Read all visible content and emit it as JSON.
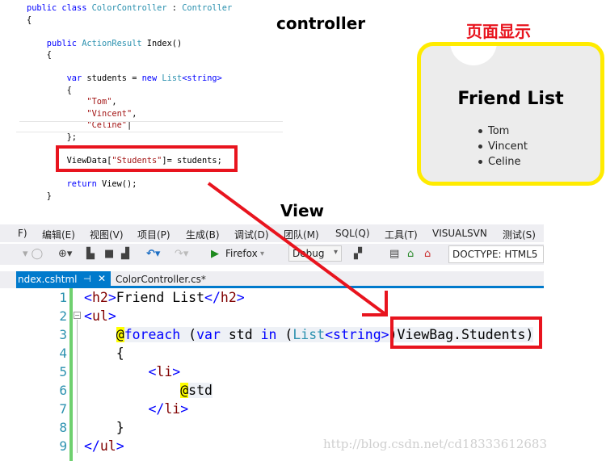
{
  "colors": {
    "keyword": "#0000ff",
    "type": "#2b91af",
    "string": "#a31515",
    "tag": "#800000",
    "plain": "#000000",
    "accent": "#007acc",
    "highlight_box": "#e8141e",
    "panel_border": "#ffeb00"
  },
  "labels": {
    "controller": "controller",
    "view": "View",
    "page_display": "页面显示"
  },
  "controller_code": [
    [
      [
        "public class ",
        "keyword"
      ],
      [
        "ColorController",
        "type"
      ],
      [
        " : ",
        "plain"
      ],
      [
        "Controller",
        "type"
      ]
    ],
    [
      [
        "{",
        "plain"
      ]
    ],
    [],
    [
      [
        "    public ",
        "keyword"
      ],
      [
        "ActionResult",
        "type"
      ],
      [
        " Index()",
        "plain"
      ]
    ],
    [
      [
        "    {",
        "plain"
      ]
    ],
    [],
    [
      [
        "        var",
        "keyword"
      ],
      [
        " students = ",
        "plain"
      ],
      [
        "new ",
        "keyword"
      ],
      [
        "List",
        "type"
      ],
      [
        "<string>",
        "keyword"
      ]
    ],
    [
      [
        "        {",
        "plain"
      ]
    ],
    [
      [
        "            \"Tom\"",
        "string"
      ],
      [
        ",",
        "plain"
      ]
    ],
    [
      [
        "            \"Vincent\"",
        "string"
      ],
      [
        ",",
        "plain"
      ]
    ],
    [
      [
        "            \"Celine\"",
        "string"
      ],
      [
        "|",
        "plain"
      ]
    ],
    [
      [
        "        };",
        "plain"
      ]
    ],
    [],
    [
      [
        "        ViewData[",
        "plain"
      ],
      [
        "\"Students\"",
        "string"
      ],
      [
        "]= students;",
        "plain"
      ]
    ],
    [],
    [
      [
        "        return",
        "keyword"
      ],
      [
        " View();",
        "plain"
      ]
    ],
    [
      [
        "    }",
        "plain"
      ]
    ]
  ],
  "browser_preview": {
    "title": "Friend List",
    "items": [
      "Tom",
      "Vincent",
      "Celine"
    ]
  },
  "ide": {
    "menu": [
      "F)",
      "编辑(E)",
      "视图(V)",
      "项目(P)",
      "生成(B)",
      "调试(D)",
      "团队(M)",
      "SQL(Q)",
      "工具(T)",
      "VISUALSVN",
      "测试(S)"
    ],
    "toolbar": {
      "browser": "Firefox",
      "config": "Debug",
      "doctype": "DOCTYPE:  HTML5"
    },
    "tabs": [
      {
        "label": "ndex.cshtml",
        "active": true
      },
      {
        "label": "ColorController.cs*",
        "active": false
      }
    ],
    "line_numbers": [
      "1",
      "2",
      "3",
      "4",
      "5",
      "6",
      "7",
      "8",
      "9"
    ],
    "view_code": [
      [
        [
          "<",
          "keyword"
        ],
        [
          "h2",
          "tag"
        ],
        [
          ">",
          "keyword"
        ],
        [
          "Friend List",
          "plain"
        ],
        [
          "</",
          "keyword"
        ],
        [
          "h2",
          "tag"
        ],
        [
          ">",
          "keyword"
        ]
      ],
      [
        [
          "<",
          "keyword"
        ],
        [
          "ul",
          "tag"
        ],
        [
          ">",
          "keyword"
        ]
      ],
      [
        [
          "    ",
          "plain"
        ],
        [
          "@",
          "at"
        ],
        [
          "foreach",
          "keyword"
        ],
        [
          " (",
          "plain"
        ],
        [
          "var",
          "keyword"
        ],
        [
          " std ",
          "plain"
        ],
        [
          "in",
          "keyword"
        ],
        [
          " (",
          "plain"
        ],
        [
          "List",
          "type"
        ],
        [
          "<string>",
          "keyword"
        ],
        [
          ")ViewBag.Students)",
          "plain"
        ]
      ],
      [
        [
          "    {",
          "plain"
        ]
      ],
      [
        [
          "        <",
          "keyword"
        ],
        [
          "li",
          "tag"
        ],
        [
          ">",
          "keyword"
        ]
      ],
      [
        [
          "            ",
          "plain"
        ],
        [
          "@",
          "at"
        ],
        [
          "std",
          "plain"
        ]
      ],
      [
        [
          "        </",
          "keyword"
        ],
        [
          "li",
          "tag"
        ],
        [
          ">",
          "keyword"
        ]
      ],
      [
        [
          "    }",
          "plain"
        ]
      ],
      [
        [
          "</",
          "keyword"
        ],
        [
          "ul",
          "tag"
        ],
        [
          ">",
          "keyword"
        ]
      ]
    ]
  },
  "watermark": "http://blog.csdn.net/cd18333612683"
}
